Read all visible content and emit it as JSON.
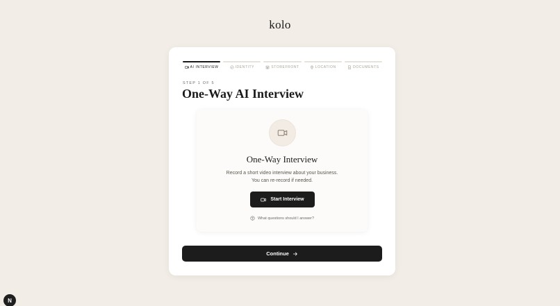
{
  "brand": {
    "logo_text": "kolo"
  },
  "stepper": {
    "steps": [
      {
        "label": "AI INTERVIEW",
        "icon": "video-camera-icon",
        "active": true
      },
      {
        "label": "IDENTITY",
        "icon": "check-circle-icon",
        "active": false
      },
      {
        "label": "STOREFRONT",
        "icon": "storefront-icon",
        "active": false
      },
      {
        "label": "LOCATION",
        "icon": "map-pin-icon",
        "active": false
      },
      {
        "label": "DOCUMENTS",
        "icon": "document-icon",
        "active": false
      }
    ]
  },
  "header": {
    "step_meta": "STEP 1 OF 5",
    "title": "One-Way AI Interview"
  },
  "interview_panel": {
    "icon": "video-camera-icon",
    "title": "One-Way Interview",
    "description_line1": "Record a short video interview about your business.",
    "description_line2": "You can re-record if needed.",
    "start_button_label": "Start Interview",
    "help_link_text": "What questions should I answer?"
  },
  "footer": {
    "continue_label": "Continue"
  },
  "dev_badge": {
    "label": "N"
  },
  "colors": {
    "page_background": "#f2ede6",
    "card_background": "#ffffff",
    "primary_button": "#1c1c1c",
    "active_step": "#1a1a1a",
    "inactive_step": "#e7e2da",
    "muted_text": "#a9a39a"
  }
}
